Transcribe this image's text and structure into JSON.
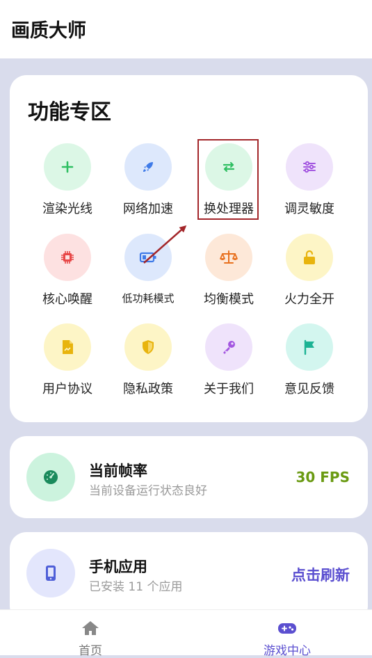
{
  "app_title": "画质大师",
  "features": {
    "title": "功能专区",
    "items": [
      {
        "label": "渲染光线",
        "icon": "plus-icon"
      },
      {
        "label": "网络加速",
        "icon": "rocket-icon"
      },
      {
        "label": "换处理器",
        "icon": "swap-arrows-icon"
      },
      {
        "label": "调灵敏度",
        "icon": "sliders-icon"
      },
      {
        "label": "核心唤醒",
        "icon": "chip-icon"
      },
      {
        "label": "低功耗模式",
        "icon": "battery-icon"
      },
      {
        "label": "均衡模式",
        "icon": "balance-scale-icon"
      },
      {
        "label": "火力全开",
        "icon": "unlock-icon"
      },
      {
        "label": "用户协议",
        "icon": "document-icon"
      },
      {
        "label": "隐私政策",
        "icon": "shield-icon"
      },
      {
        "label": "关于我们",
        "icon": "key-icon"
      },
      {
        "label": "意见反馈",
        "icon": "flag-icon"
      }
    ]
  },
  "fps_card": {
    "title": "当前帧率",
    "subtitle": "当前设备运行状态良好",
    "value": "30 FPS"
  },
  "apps_card": {
    "title": "手机应用",
    "subtitle": "已安装 11 个应用",
    "action": "点击刷新"
  },
  "bottom_nav": {
    "home": "首页",
    "game_center": "游戏中心"
  },
  "colors": {
    "accent_purple": "#5b4fd0",
    "fps_green": "#6a9a12",
    "highlight_red": "#a3262a"
  }
}
